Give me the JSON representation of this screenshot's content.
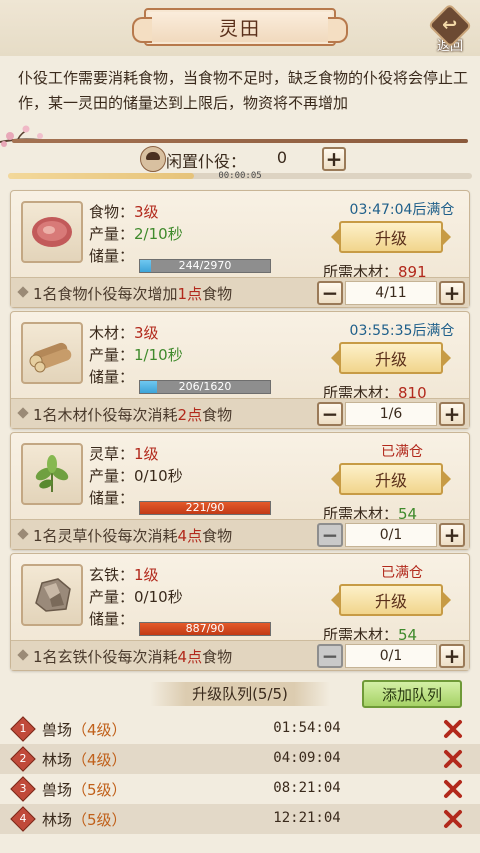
{
  "header": {
    "title": "灵田",
    "back_label": "返回"
  },
  "notice": "仆役工作需要消耗食物，当食物不足时，缺乏食物的仆役将会停止工作，某一灵田的储量达到上限后，物资将不再增加",
  "idle": {
    "label": "闲置仆役：",
    "count": "0",
    "timer": "00:00:05"
  },
  "cards": [
    {
      "name_label": "食物：",
      "level": "3级",
      "rate_label": "产量：",
      "rate": "2/10秒",
      "stock_label": "储量：",
      "stock": "244/2970",
      "stock_ratio": 0.082,
      "full": false,
      "status": "03:47:04后满仓",
      "upgrade_label": "升级",
      "need_label": "所需木材：",
      "need_value": "891",
      "need_ok": false,
      "footer_pre": "1名食物仆役每次增加",
      "footer_hl": "1点",
      "footer_post": "食物",
      "stepper": "4/11",
      "minus_enabled": true,
      "icon": "meat-icon"
    },
    {
      "name_label": "木材：",
      "level": "3级",
      "rate_label": "产量：",
      "rate": "1/10秒",
      "stock_label": "储量：",
      "stock": "206/1620",
      "stock_ratio": 0.127,
      "full": false,
      "status": "03:55:35后满仓",
      "upgrade_label": "升级",
      "need_label": "所需木材：",
      "need_value": "810",
      "need_ok": false,
      "footer_pre": "1名木材仆役每次消耗",
      "footer_hl": "2点",
      "footer_post": "食物",
      "stepper": "1/6",
      "minus_enabled": true,
      "icon": "log-icon"
    },
    {
      "name_label": "灵草：",
      "level": "1级",
      "rate_label": "产量：",
      "rate": "0/10秒",
      "stock_label": "储量：",
      "stock": "221/90",
      "stock_ratio": 1,
      "full": true,
      "status": "已满仓",
      "upgrade_label": "升级",
      "need_label": "所需木材：",
      "need_value": "54",
      "need_ok": true,
      "footer_pre": "1名灵草仆役每次消耗",
      "footer_hl": "4点",
      "footer_post": "食物",
      "stepper": "0/1",
      "minus_enabled": false,
      "icon": "herb-icon"
    },
    {
      "name_label": "玄铁：",
      "level": "1级",
      "rate_label": "产量：",
      "rate": "0/10秒",
      "stock_label": "储量：",
      "stock": "887/90",
      "stock_ratio": 1,
      "full": true,
      "status": "已满仓",
      "upgrade_label": "升级",
      "need_label": "所需木材：",
      "need_value": "54",
      "need_ok": true,
      "footer_pre": "1名玄铁仆役每次消耗",
      "footer_hl": "4点",
      "footer_post": "食物",
      "stepper": "0/1",
      "minus_enabled": false,
      "icon": "ore-icon"
    }
  ],
  "queue": {
    "title": "升级队列(5/5)",
    "add_label": "添加队列",
    "items": [
      {
        "num": "1",
        "name": "兽场",
        "level": "（4级）",
        "time": "01:54:04"
      },
      {
        "num": "2",
        "name": "林场",
        "level": "（4级）",
        "time": "04:09:04"
      },
      {
        "num": "3",
        "name": "兽场",
        "level": "（5级）",
        "time": "08:21:04"
      },
      {
        "num": "4",
        "name": "林场",
        "level": "（5级）",
        "time": "12:21:04"
      }
    ]
  },
  "colors": {
    "level_red": "#b2291c",
    "rate_green": "#3f8a2c",
    "timer_blue": "#1e5f8a",
    "stock_blue": "#3ea4d8",
    "stock_full": "#c23a16"
  }
}
